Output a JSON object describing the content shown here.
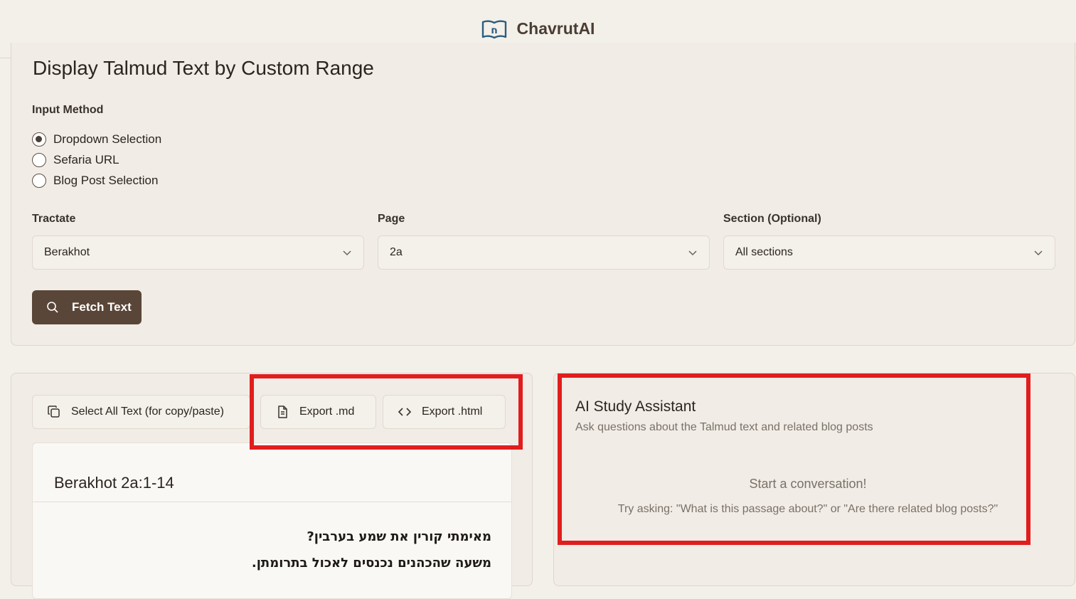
{
  "app": {
    "name": "ChavrutAI",
    "logo_letter": "ח"
  },
  "form": {
    "title": "Display Talmud Text by Custom Range",
    "input_method_label": "Input Method",
    "input_methods": [
      {
        "label": "Dropdown Selection",
        "checked": true
      },
      {
        "label": "Sefaria URL",
        "checked": false
      },
      {
        "label": "Blog Post Selection",
        "checked": false
      }
    ],
    "tractate": {
      "label": "Tractate",
      "value": "Berakhot"
    },
    "page": {
      "label": "Page",
      "value": "2a"
    },
    "section": {
      "label": "Section (Optional)",
      "value": "All sections"
    },
    "fetch_label": "Fetch Text"
  },
  "toolbar": {
    "select_all_label": "Select All Text (for copy/paste)",
    "export_md_label": "Export .md",
    "export_html_label": "Export .html"
  },
  "text": {
    "ref": "Berakhot 2a:1-14",
    "lines": [
      "מאימתי קורין את שמע בערבין?",
      "משעה שהכהנים נכנסים לאכול בתרומתן."
    ]
  },
  "assistant": {
    "title": "AI Study Assistant",
    "subtitle": "Ask questions about the Talmud text and related blog posts",
    "empty_title": "Start a conversation!",
    "empty_hint": "Try asking: \"What is this passage about?\" or \"Are there related blog posts?\""
  },
  "colors": {
    "highlight": "#e11d1d",
    "primary_button": "#5a4638",
    "background": "#f3efe9"
  }
}
